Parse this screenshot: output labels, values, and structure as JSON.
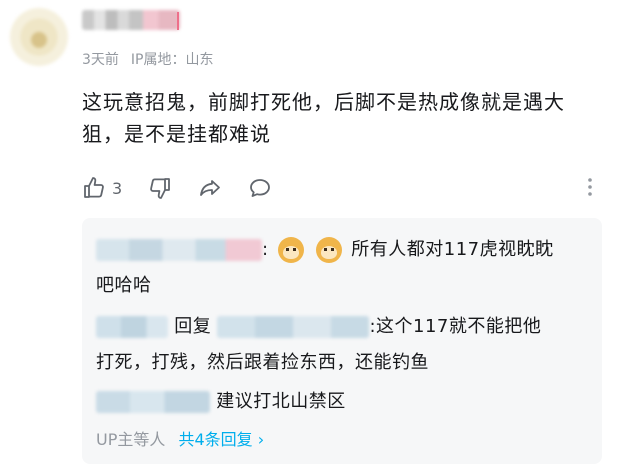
{
  "comment": {
    "meta_time": "3天前",
    "meta_ip": "IP属地：山东",
    "content": "这玩意招鬼，前脚打死他，后脚不是热成像就是遇大狙，是不是挂都难说",
    "like_count": "3"
  },
  "replies": [
    {
      "sep": ":",
      "text_line1": "所有人都对117虎视眈眈",
      "text_line2": "吧哈哈"
    },
    {
      "reply_label": "回复",
      "text_line1": ":这个117就不能把他",
      "text_line2": "打死，打残，然后跟着捡东西，还能钓鱼"
    },
    {
      "text": "建议打北山禁区"
    }
  ],
  "reply_footer": {
    "label": "UP主等人",
    "more": "共4条回复 ›"
  },
  "colors": {
    "meta_gray": "#9499a0",
    "link_blue": "#00aeec",
    "reply_bg": "#f6f7f8"
  },
  "icons": [
    "thumbs-up-icon",
    "thumbs-down-icon",
    "share-icon",
    "comment-icon",
    "more-vertical-icon",
    "doge-emoji-icon"
  ]
}
